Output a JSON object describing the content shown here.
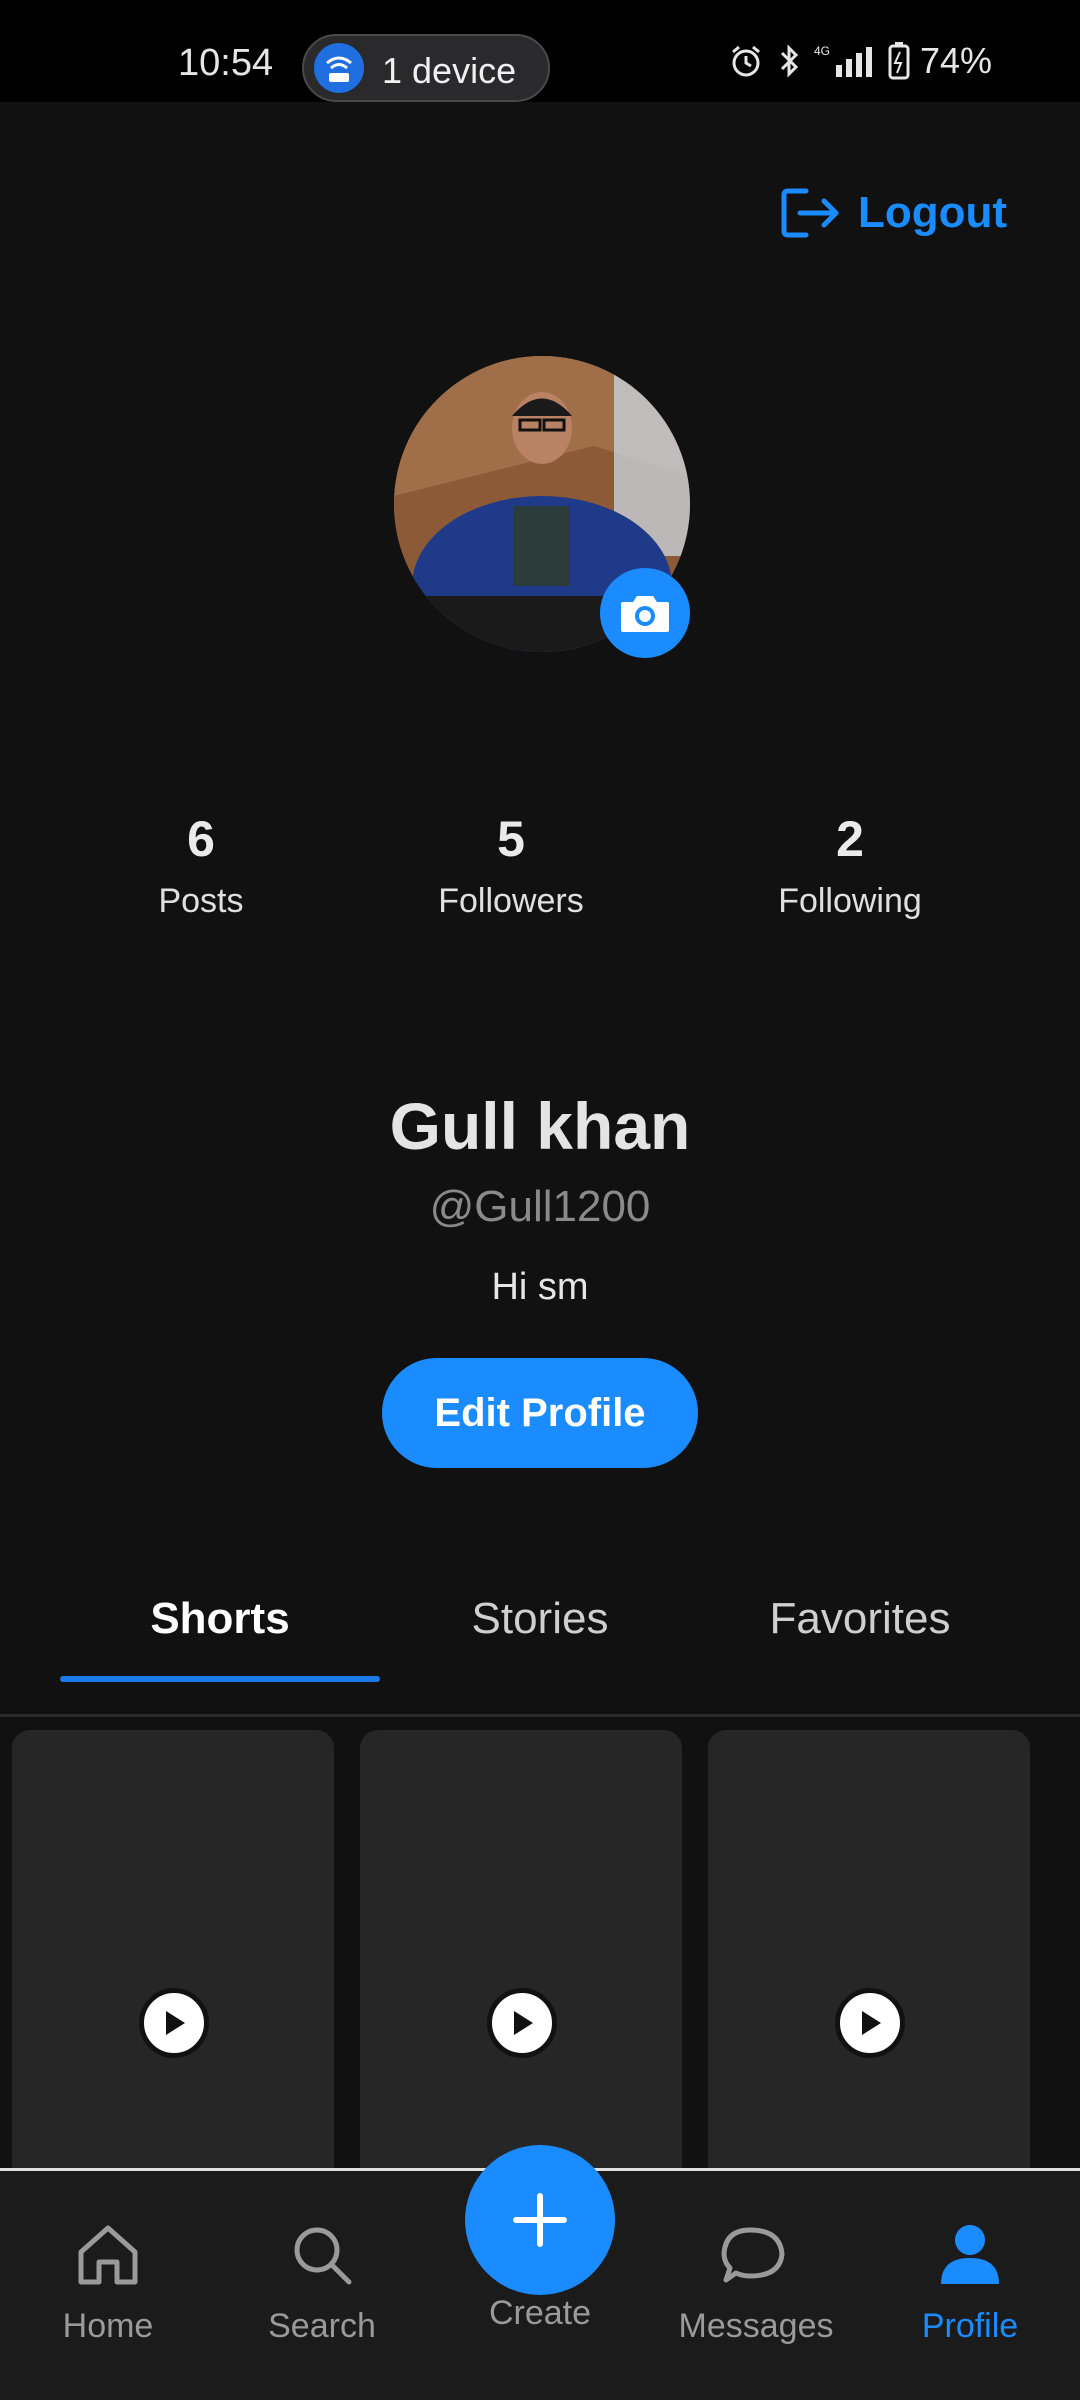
{
  "status_bar": {
    "time": "10:54",
    "hotspot_label": "1 device",
    "battery": "74%",
    "network": "4G"
  },
  "header": {
    "logout_label": "Logout"
  },
  "profile": {
    "stats": [
      {
        "value": "6",
        "label": "Posts"
      },
      {
        "value": "5",
        "label": "Followers"
      },
      {
        "value": "2",
        "label": "Following"
      }
    ],
    "name": "Gull khan",
    "handle": "@Gull1200",
    "bio": "Hi sm",
    "edit_label": "Edit Profile"
  },
  "tabs": [
    {
      "label": "Shorts",
      "active": true
    },
    {
      "label": "Stories",
      "active": false
    },
    {
      "label": "Favorites",
      "active": false
    }
  ],
  "bottom_nav": {
    "home": "Home",
    "search": "Search",
    "create": "Create",
    "messages": "Messages",
    "profile": "Profile"
  },
  "colors": {
    "accent": "#1a8cff",
    "background": "#111112",
    "card": "#262627"
  }
}
